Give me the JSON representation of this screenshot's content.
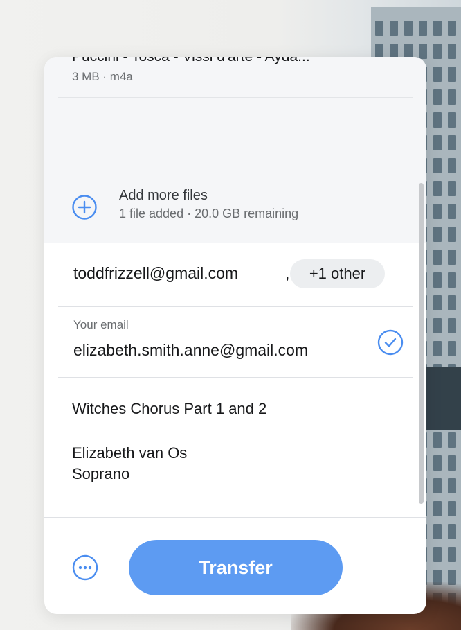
{
  "files": {
    "items": [
      {
        "name": "Puccini - Tosca - Vissi d'arte - Ayda...",
        "meta": "3 MB · m4a"
      }
    ],
    "add_more_title": "Add more files",
    "add_more_subtitle": "1 file added · 20.0 GB remaining"
  },
  "recipients": {
    "email": "toddfrizzell@gmail.com",
    "separator": ",",
    "more_chip": "+1 other"
  },
  "sender": {
    "label": "Your email",
    "email": "elizabeth.smith.anne@gmail.com"
  },
  "message": {
    "title": "Witches Chorus Part 1 and 2",
    "body": "Elizabeth van Os\nSoprano"
  },
  "footer": {
    "transfer_label": "Transfer"
  },
  "icons": {
    "add": "plus-circle-icon",
    "verified": "check-circle-icon",
    "more": "ellipsis-circle-icon"
  },
  "colors": {
    "accent": "#5d9bf2",
    "icon_blue": "#4a8df0",
    "panel_gray": "#f5f6f8"
  }
}
